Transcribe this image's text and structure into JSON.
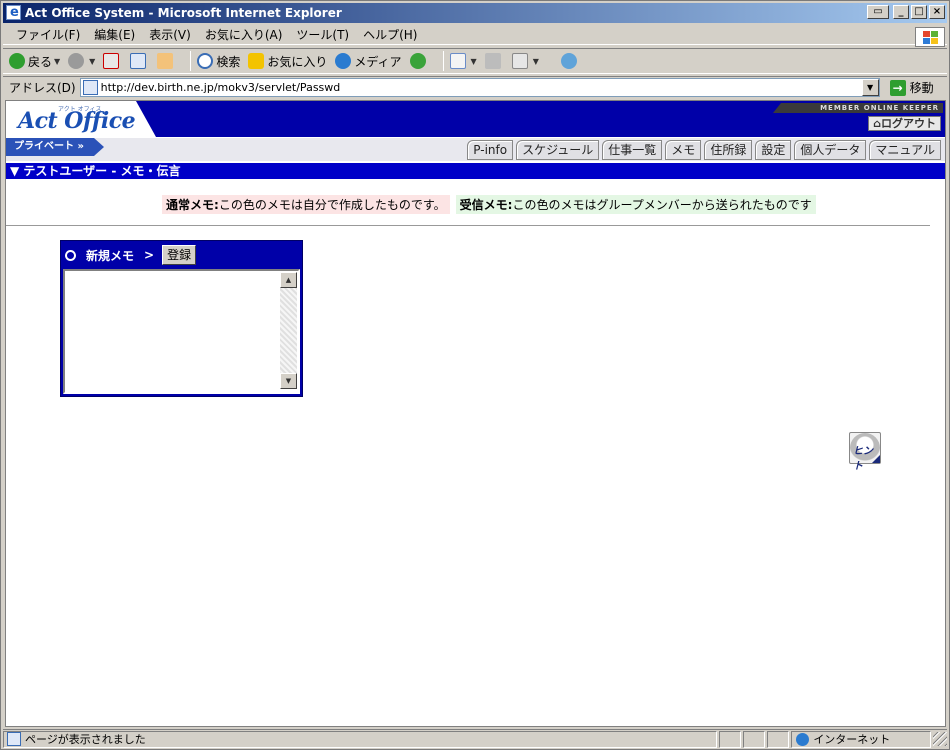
{
  "window": {
    "title": "Act Office System - Microsoft Internet Explorer"
  },
  "menubar": {
    "items": [
      "ファイル(F)",
      "編集(E)",
      "表示(V)",
      "お気に入り(A)",
      "ツール(T)",
      "ヘルプ(H)"
    ]
  },
  "toolbar": {
    "back": "戻る",
    "search": "検索",
    "favorites": "お気に入り",
    "media": "メディア"
  },
  "addressbar": {
    "label": "アドレス(D)",
    "url": "http://dev.birth.ne.jp/mokv3/servlet/Passwd",
    "go": "移動"
  },
  "site": {
    "logo": "Act Office",
    "logo_kana": "アクト オフィス",
    "tagline": "MEMBER ONLINE KEEPER",
    "logout": "ログアウト",
    "private_tab": "プライベート",
    "nav_tabs": [
      "P-info",
      "スケジュール",
      "仕事一覧",
      "メモ",
      "住所録",
      "設定",
      "個人データ",
      "マニュアル"
    ],
    "section_title": "▼ テストユーザー - メモ・伝言"
  },
  "legend": {
    "normal_label": "通常メモ:",
    "normal_text": "この色のメモは自分で作成したものです。",
    "recv_label": "受信メモ:",
    "recv_text": "この色のメモはグループメンバーから送られたものです"
  },
  "memo": {
    "title": "新規メモ",
    "gt": ">",
    "register": "登録",
    "content": ""
  },
  "hint": {
    "label": "ヒント"
  },
  "statusbar": {
    "text": "ページが表示されました",
    "zone": "インターネット"
  }
}
